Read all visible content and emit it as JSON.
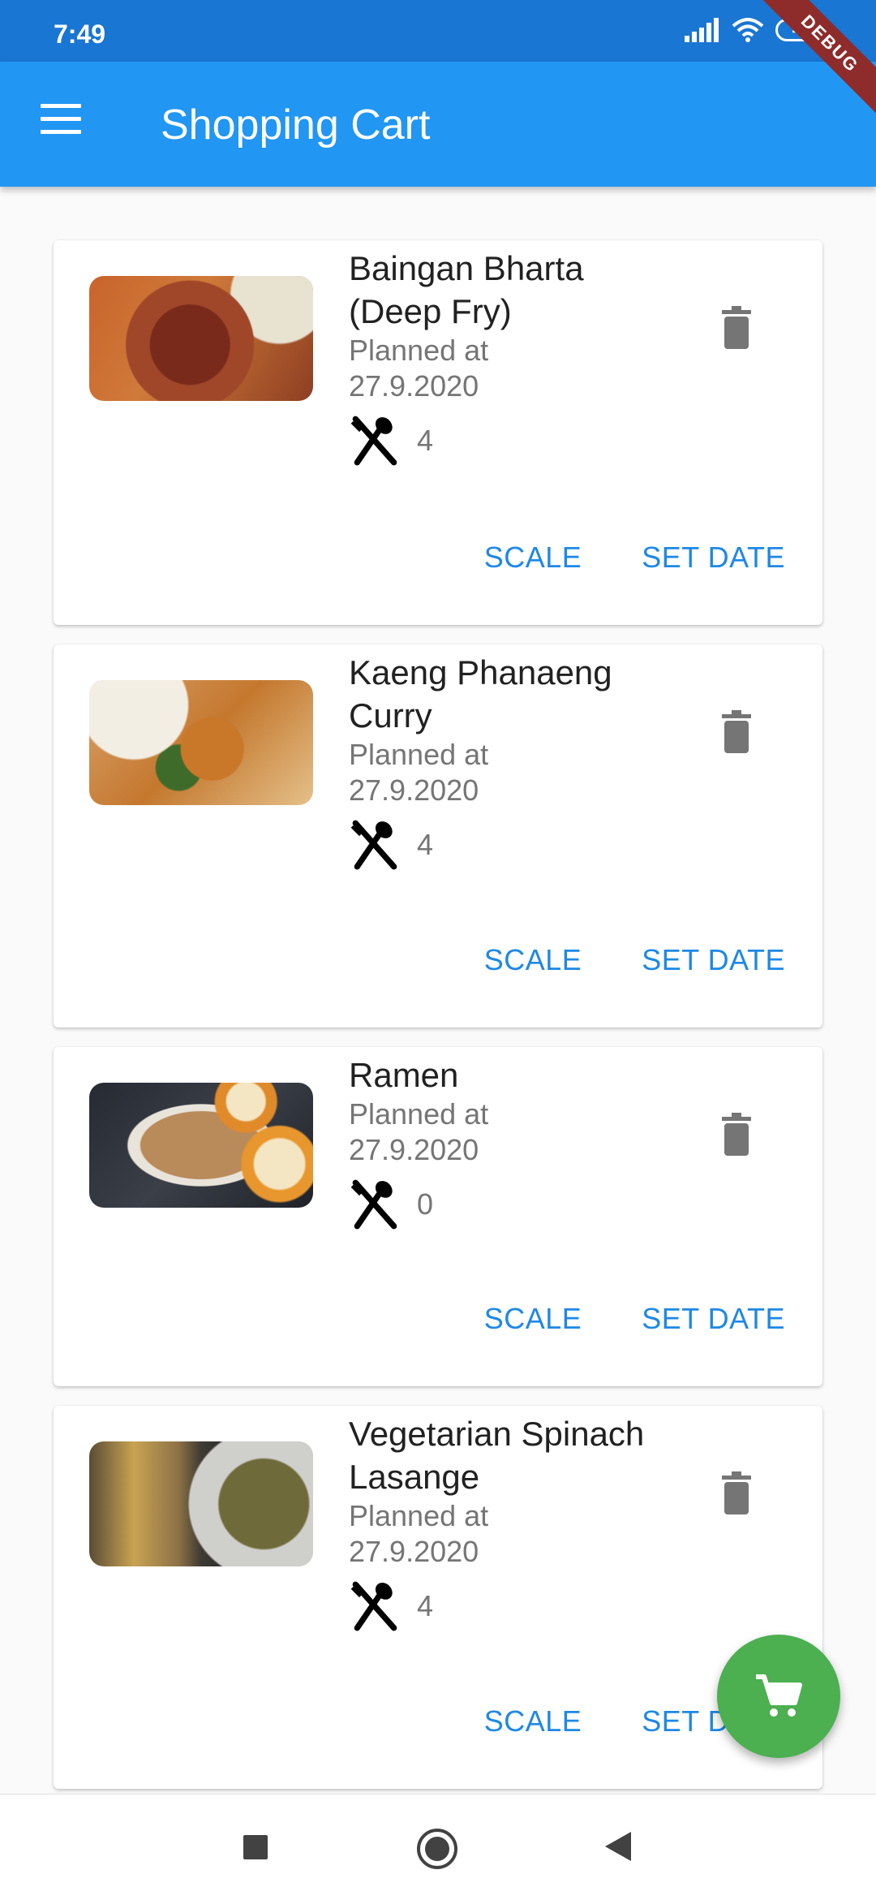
{
  "status_bar": {
    "time": "7:49",
    "battery": "48"
  },
  "debug_banner": "DEBUG",
  "app_bar": {
    "title": "Shopping Cart",
    "menu_icon": "menu-icon"
  },
  "colors": {
    "app_bar": "#2196f3",
    "status_bar": "#1976d2",
    "accent": "#1e88e5",
    "fab": "#4caf50"
  },
  "cart_items": [
    {
      "title": "Baingan Bharta (Deep Fry)",
      "planned_label": "Planned at",
      "planned_date": "27.9.2020",
      "servings": "4",
      "scale_label": "SCALE",
      "set_date_label": "SET DATE"
    },
    {
      "title": "Kaeng Phanaeng Curry",
      "planned_label": "Planned at",
      "planned_date": "27.9.2020",
      "servings": "4",
      "scale_label": "SCALE",
      "set_date_label": "SET DATE"
    },
    {
      "title": "Ramen",
      "planned_label": "Planned at",
      "planned_date": "27.9.2020",
      "servings": "0",
      "scale_label": "SCALE",
      "set_date_label": "SET DATE"
    },
    {
      "title": "Vegetarian Spinach Lasange",
      "planned_label": "Planned at",
      "planned_date": "27.9.2020",
      "servings": "4",
      "scale_label": "SCALE",
      "set_date_label": "SET DATE"
    }
  ],
  "fab_icon": "shopping-cart-icon",
  "nav_bar": {
    "recents_icon": "square-icon",
    "home_icon": "circle-icon",
    "back_icon": "triangle-back-icon"
  }
}
